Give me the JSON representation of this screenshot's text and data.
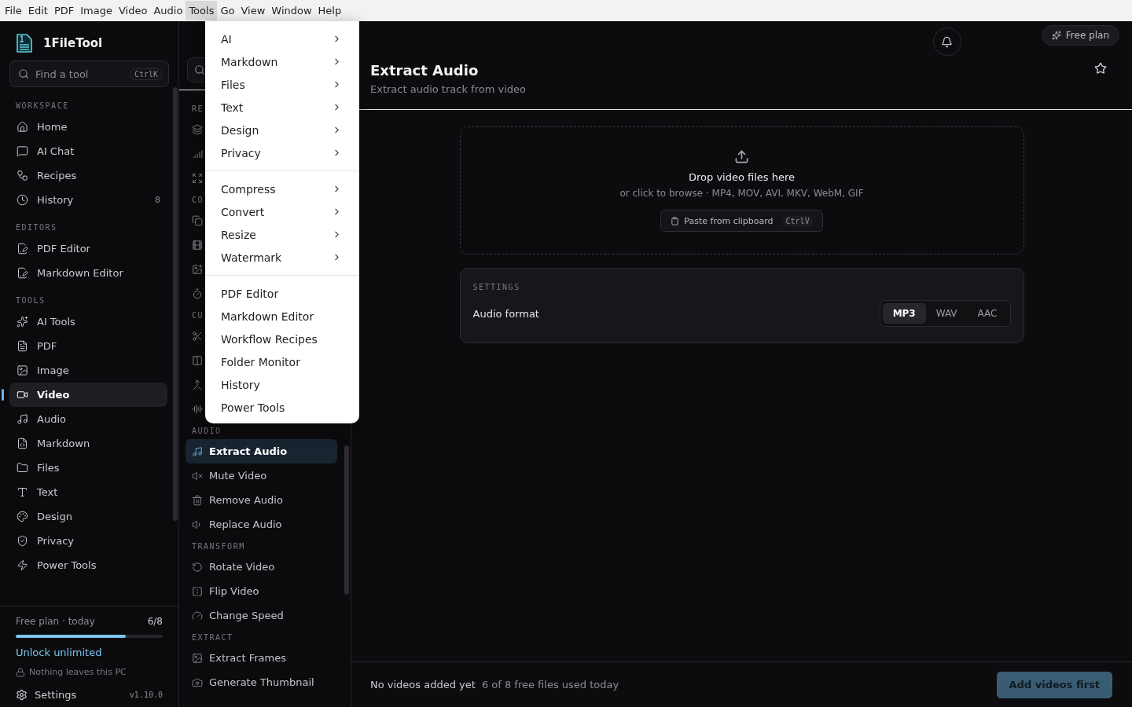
{
  "menu_bar": [
    {
      "label": "File",
      "selected": false
    },
    {
      "label": "Edit",
      "selected": false
    },
    {
      "label": "PDF",
      "selected": false
    },
    {
      "label": "Image",
      "selected": false
    },
    {
      "label": "Video",
      "selected": false
    },
    {
      "label": "Audio",
      "selected": false
    },
    {
      "label": "Tools",
      "selected": true
    },
    {
      "label": "Go",
      "selected": false
    },
    {
      "label": "View",
      "selected": false
    },
    {
      "label": "Window",
      "selected": false
    },
    {
      "label": "Help",
      "selected": false
    }
  ],
  "tools_menu": {
    "groups": [
      [
        {
          "label": "AI",
          "submenu": true
        },
        {
          "label": "Markdown",
          "submenu": true
        },
        {
          "label": "Files",
          "submenu": true
        },
        {
          "label": "Text",
          "submenu": true
        },
        {
          "label": "Design",
          "submenu": true
        },
        {
          "label": "Privacy",
          "submenu": true
        }
      ],
      [
        {
          "label": "Compress",
          "submenu": true
        },
        {
          "label": "Convert",
          "submenu": true
        },
        {
          "label": "Resize",
          "submenu": true
        },
        {
          "label": "Watermark",
          "submenu": true
        }
      ],
      [
        {
          "label": "PDF Editor",
          "submenu": false
        },
        {
          "label": "Markdown Editor",
          "submenu": false
        },
        {
          "label": "Workflow Recipes",
          "submenu": false
        },
        {
          "label": "Folder Monitor",
          "submenu": false
        },
        {
          "label": "History",
          "submenu": false
        },
        {
          "label": "Power Tools",
          "submenu": false
        }
      ]
    ]
  },
  "sidebar": {
    "app_name": "1FileTool",
    "search": {
      "placeholder": "Find a tool",
      "shortcut": "CtrlK"
    },
    "sections": [
      {
        "title": "WORKSPACE",
        "items": [
          {
            "label": "Home",
            "selected": false
          },
          {
            "label": "AI Chat",
            "selected": false
          },
          {
            "label": "Recipes",
            "selected": false
          },
          {
            "label": "History",
            "count": "8",
            "selected": false
          }
        ]
      },
      {
        "title": "EDITORS",
        "items": [
          {
            "label": "PDF Editor",
            "selected": false
          },
          {
            "label": "Markdown Editor",
            "selected": false
          }
        ]
      },
      {
        "title": "TOOLS",
        "items": [
          {
            "label": "AI Tools",
            "selected": false
          },
          {
            "label": "PDF",
            "selected": false
          },
          {
            "label": "Image",
            "selected": false
          },
          {
            "label": "Video",
            "selected": true
          },
          {
            "label": "Audio",
            "selected": false
          },
          {
            "label": "Markdown",
            "selected": false
          },
          {
            "label": "Files",
            "selected": false
          },
          {
            "label": "Text",
            "selected": false
          },
          {
            "label": "Design",
            "selected": false
          },
          {
            "label": "Privacy",
            "selected": false
          },
          {
            "label": "Power Tools",
            "selected": false
          }
        ]
      }
    ],
    "plan": {
      "label": "Free plan · today",
      "count": "6/8",
      "level": 0.75,
      "link": "Unlock unlimited",
      "privacy_note": "Nothing leaves this PC"
    },
    "settings": {
      "label": "Settings",
      "version": "v1.10.0"
    }
  },
  "tool_list": {
    "sections": [
      {
        "title": "RE",
        "items": [
          {
            "selected": false
          },
          {
            "selected": false
          },
          {
            "selected": false
          }
        ]
      },
      {
        "title": "CO",
        "items": [
          {
            "selected": false
          },
          {
            "selected": false
          },
          {
            "selected": false
          },
          {
            "selected": false
          }
        ]
      },
      {
        "title": "CU",
        "items": [
          {
            "selected": false
          },
          {
            "selected": false
          },
          {
            "selected": false
          },
          {
            "selected": false
          }
        ]
      },
      {
        "title": "AUDIO",
        "items": [
          {
            "label": "Extract Audio",
            "selected": true
          },
          {
            "label": "Mute Video",
            "selected": false
          },
          {
            "label": "Remove Audio",
            "selected": false
          },
          {
            "label": "Replace Audio",
            "selected": false
          }
        ]
      },
      {
        "title": "TRANSFORM",
        "items": [
          {
            "label": "Rotate Video",
            "selected": false
          },
          {
            "label": "Flip Video",
            "selected": false
          },
          {
            "label": "Change Speed",
            "selected": false
          }
        ]
      },
      {
        "title": "EXTRACT",
        "items": [
          {
            "label": "Extract Frames",
            "selected": false
          },
          {
            "label": "Generate Thumbnail",
            "selected": false
          }
        ]
      }
    ]
  },
  "header": {
    "plan_badge": "Free plan",
    "title": "Extract Audio",
    "subtitle": "Extract audio track from video"
  },
  "dropzone": {
    "title": "Drop video files here",
    "hint": "or click to browse · MP4, MOV, AVI, MKV, WebM, GIF",
    "paste_button": "Paste from clipboard",
    "paste_shortcut": "CtrlV"
  },
  "settings_card": {
    "title": "SETTINGS",
    "label": "Audio format",
    "options": [
      {
        "label": "MP3",
        "selected": true
      },
      {
        "label": "WAV",
        "selected": false
      },
      {
        "label": "AAC",
        "selected": false
      }
    ]
  },
  "footer": {
    "status": "No videos added yet",
    "usage": "6 of 8 free files used today",
    "action": "Add videos first",
    "disabled": true
  }
}
